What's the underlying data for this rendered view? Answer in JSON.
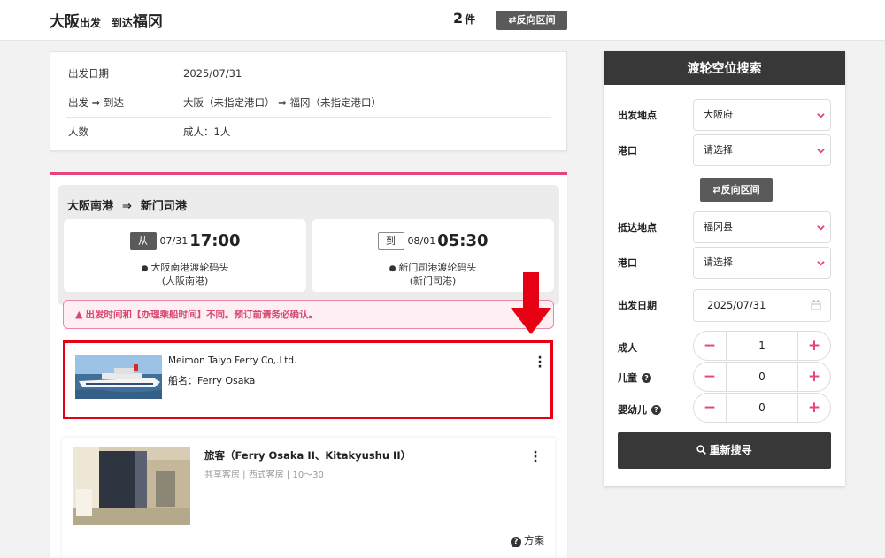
{
  "header": {
    "from_city": "大阪",
    "from_suffix": "出发",
    "to_prefix": "到达",
    "to_city": "福冈",
    "count": "2",
    "count_unit": "件",
    "reverse_label": "反向区间"
  },
  "summary": {
    "rows": [
      {
        "label": "出发日期",
        "value": "2025/07/31"
      },
      {
        "label": "出发 ⇒ 到达",
        "value": "大阪（未指定港口） ⇒ 福冈（未指定港口）"
      },
      {
        "label": "人数",
        "value": "成人：1人"
      }
    ]
  },
  "result": {
    "from_port": "大阪南港",
    "arrow": "⇒",
    "to_port": "新门司港",
    "departure": {
      "tag": "从",
      "date": "07/31",
      "time": "17:00",
      "terminal_line1": "大阪南港渡轮码头",
      "terminal_line2": "(大阪南港)"
    },
    "arrival": {
      "tag": "到",
      "date": "08/01",
      "time": "05:30",
      "terminal_line1": "新门司港渡轮码头",
      "terminal_line2": "(新门司港)"
    },
    "warning": "出发时间和【办理乘船时间】不同。预订前请务必确认。",
    "operator": {
      "company": "Meimon Taiyo Ferry Co,.Ltd.",
      "ship_label": "船名：",
      "ship_name": "Ferry Osaka"
    },
    "room": {
      "title": "旅客（Ferry Osaka II、Kitakyushu II）",
      "subtitle": "共享客房 | 西式客房 | 10～30",
      "plan_label": "方案"
    }
  },
  "search_panel": {
    "title": "渡轮空位搜索",
    "departure_area_label": "出发地点",
    "departure_area_value": "大阪府",
    "departure_port_label": "港口",
    "departure_port_value": "请选择",
    "reverse_label": "反向区间",
    "arrival_area_label": "抵达地点",
    "arrival_area_value": "福冈县",
    "arrival_port_label": "港口",
    "arrival_port_value": "请选择",
    "date_label": "出发日期",
    "date_value": "2025/07/31",
    "adults_label": "成人",
    "adults_value": "1",
    "children_label": "儿童",
    "children_value": "0",
    "infants_label": "婴幼儿",
    "infants_value": "0",
    "search_label": "重新搜寻"
  },
  "colors": {
    "accent": "#e4457a",
    "highlight_red": "#e60012",
    "dark": "#383838",
    "button_gray": "#5a5a5a"
  }
}
